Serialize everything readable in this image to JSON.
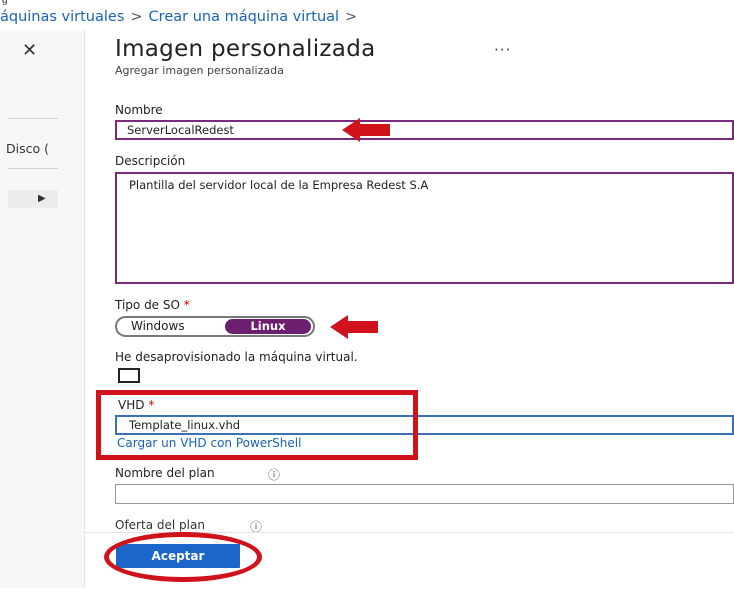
{
  "breadcrumb": {
    "part1": "áquinas virtuales",
    "part2": "Crear una máquina virtual",
    "separator": ">"
  },
  "left_blade": {
    "close_icon": "close-icon",
    "item_label": "Disco (",
    "expand_icon": "triangle-right-icon"
  },
  "header": {
    "title": "Imagen personalizada",
    "more": "···",
    "subtitle": "Agregar imagen personalizada"
  },
  "form": {
    "name_label": "Nombre",
    "name_value": "ServerLocalRedest",
    "description_label": "Descripción",
    "description_value": "Plantilla del servidor local de la Empresa Redest S.A",
    "os_label": "Tipo de SO",
    "required_mark": "*",
    "os_options": [
      "Windows",
      "Linux"
    ],
    "os_selected": "Linux",
    "deprovisioned_label": "He desaprovisionado la máquina virtual.",
    "deprovisioned_checked": false,
    "vhd_label": "VHD",
    "vhd_value": "Template_linux.vhd",
    "vhd_link": "Cargar un VHD con PowerShell",
    "plan_name_label": "Nombre del plan",
    "plan_name_value": "",
    "plan_offer_label": "Oferta del plan",
    "info_icon": "info-icon"
  },
  "footer": {
    "accept_label": "Aceptar"
  },
  "colors": {
    "accent_purple": "#6b1f6e",
    "primary_blue": "#1a66c9",
    "link_blue": "#1a64b3",
    "annotation_red": "#d0121b"
  }
}
